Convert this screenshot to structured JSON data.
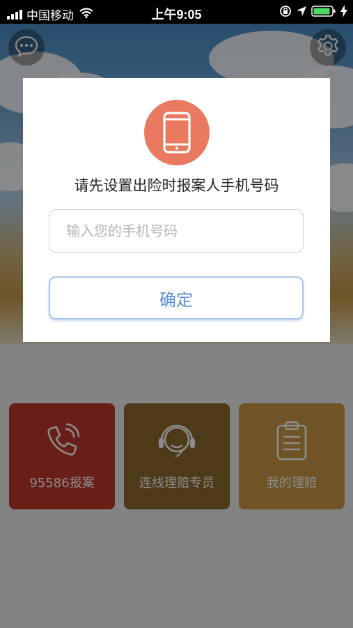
{
  "status_bar": {
    "carrier": "中国移动",
    "time": "上午9:05",
    "icons": [
      "signal-icon",
      "wifi-icon",
      "orientation-lock-icon",
      "location-icon",
      "battery-icon",
      "charging-icon"
    ]
  },
  "header": {
    "message_icon": "chat-bubble-icon",
    "settings_icon": "gear-icon"
  },
  "tiles": [
    {
      "label": "95586报案",
      "icon": "phone-ringing-icon",
      "color": "#c0392b"
    },
    {
      "label": "连线理赔专员",
      "icon": "headset-agent-icon",
      "color": "#8a6a2e"
    },
    {
      "label": "我的理赔",
      "icon": "clipboard-icon",
      "color": "#cc9a45"
    }
  ],
  "dialog": {
    "icon": "mobile-phone-icon",
    "icon_color": "#e97a60",
    "title": "请先设置出险时报案人手机号码",
    "phone_input": {
      "value": "",
      "placeholder": "输入您的手机号码"
    },
    "confirm_label": "确定",
    "accent_color": "#5a8fd9"
  }
}
